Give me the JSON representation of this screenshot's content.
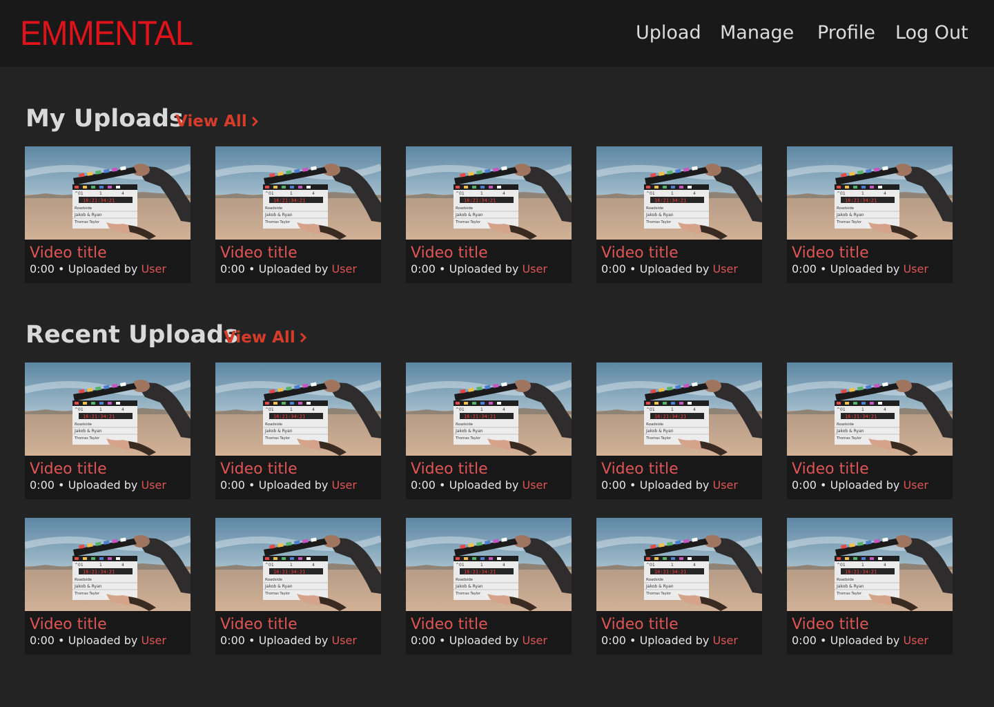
{
  "header": {
    "logo": "EMMENTAL",
    "nav": {
      "upload": "Upload",
      "manage": "Manage",
      "profile": "Profile",
      "logout": "Log Out"
    }
  },
  "sections": {
    "my_uploads": {
      "title": "My Uploads",
      "view_all": "View All"
    },
    "recent_uploads": {
      "title": "Recent Uploads",
      "view_all": "View All"
    }
  },
  "video": {
    "title": "Video title",
    "duration": "0:00",
    "separator": "•",
    "uploaded_by": "Uploaded by",
    "user": "User"
  },
  "clapper": {
    "row1": [
      "01",
      "1",
      "4"
    ],
    "timecode": "16:21:34:21",
    "production": "Roadside",
    "director": "Jakob & Ryan",
    "camera": "Thomas Taylor"
  },
  "colors": {
    "accent": "#e0131a",
    "link": "#d63c2a",
    "title_red": "#df5555",
    "background": "#232323",
    "header_bg": "#191919",
    "card_bg": "#181818"
  }
}
